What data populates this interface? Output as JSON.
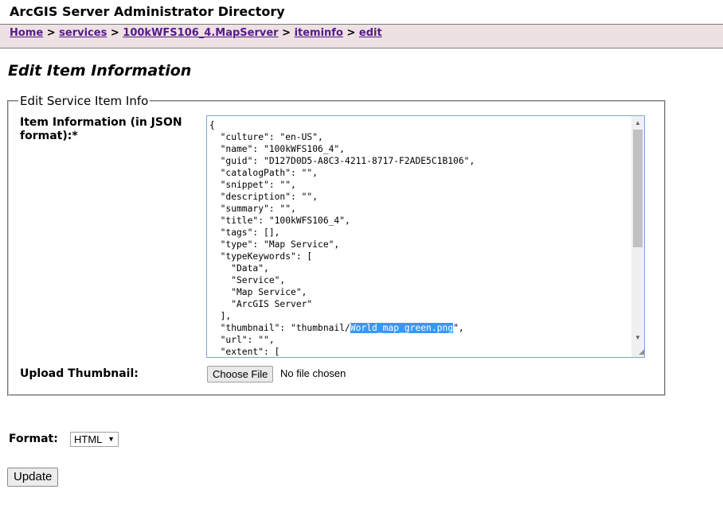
{
  "header": {
    "title": "ArcGIS Server Administrator Directory"
  },
  "breadcrumb": {
    "items": [
      "Home",
      "services",
      "100kWFS106_4.MapServer",
      "iteminfo",
      "edit"
    ],
    "separator": ">"
  },
  "page": {
    "title": "Edit Item Information"
  },
  "form": {
    "legend": "Edit Service Item Info",
    "item_info_label": "Item Information (in JSON format):*",
    "json_before_selection": "{\n  \"culture\": \"en-US\",\n  \"name\": \"100kWFS106_4\",\n  \"guid\": \"D127D0D5-A8C3-4211-8717-F2ADE5C1B106\",\n  \"catalogPath\": \"\",\n  \"snippet\": \"\",\n  \"description\": \"\",\n  \"summary\": \"\",\n  \"title\": \"100kWFS106_4\",\n  \"tags\": [],\n  \"type\": \"Map Service\",\n  \"typeKeywords\": [\n    \"Data\",\n    \"Service\",\n    \"Map Service\",\n    \"ArcGIS Server\"\n  ],\n  \"thumbnail\": \"thumbnail/",
    "json_selected": "World_map_green.png",
    "json_after_selection": "\",\n  \"url\": \"\",\n  \"extent\": [",
    "upload_label": "Upload Thumbnail:",
    "choose_file_label": "Choose File",
    "file_status": "No file chosen"
  },
  "format": {
    "label": "Format:",
    "selected": "HTML"
  },
  "update_label": "Update",
  "colors": {
    "crumb_background": "#eee1e3",
    "link": "#551a8b",
    "selection": "#3399ff"
  }
}
